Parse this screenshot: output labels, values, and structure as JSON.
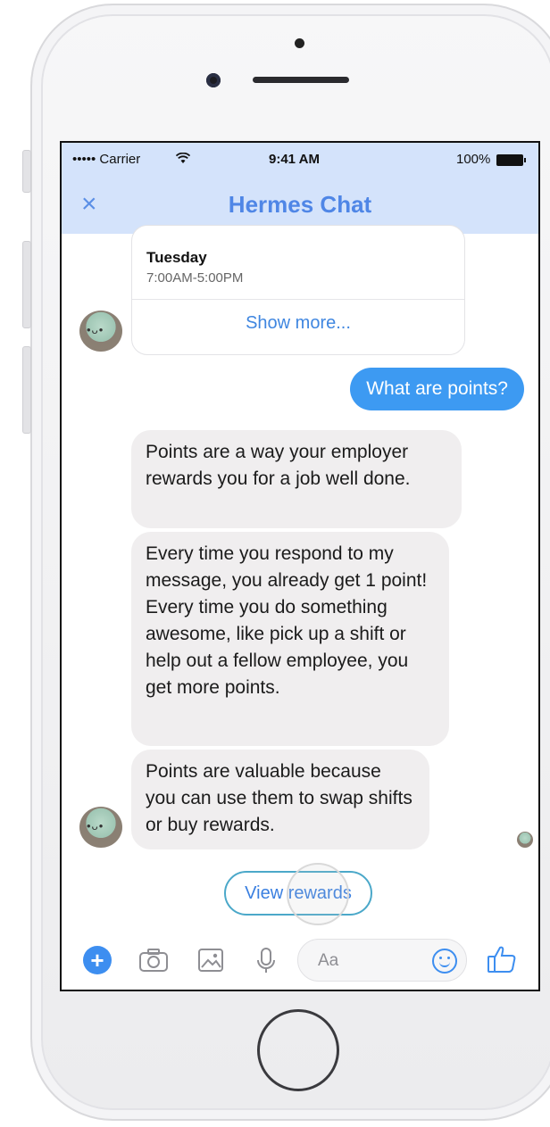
{
  "status_bar": {
    "carrier": "••••• Carrier",
    "time": "9:41 AM",
    "battery": "100%"
  },
  "nav": {
    "close_label": "×",
    "title": "Hermes Chat"
  },
  "card": {
    "day": "Tuesday",
    "hours": "7:00AM-5:00PM",
    "show_more": "Show more..."
  },
  "messages": [
    {
      "from": "user",
      "text": "What are points?"
    },
    {
      "from": "bot",
      "text": "Points are a way your employer rewards you for a job well done."
    },
    {
      "from": "bot",
      "text": "Every time you respond to my message, you already get 1 point! Every time you do something awesome, like pick up a shift or help out a fellow employee, you get more points."
    },
    {
      "from": "bot",
      "text": "Points are valuable because you can use them to swap shifts or buy rewards."
    }
  ],
  "quick_reply": "View rewards",
  "composer": {
    "placeholder": "Aa",
    "plus": "+"
  },
  "colors": {
    "accent": "#3d8ef0",
    "header_bg": "#d4e3fb",
    "bubble_bg": "#f0eeef",
    "title": "#4f86e6"
  },
  "icons": [
    "close-icon",
    "plus-icon",
    "camera-icon",
    "image-icon",
    "microphone-icon",
    "emoji-icon",
    "thumbs-up-icon",
    "wifi-icon",
    "battery-icon"
  ]
}
